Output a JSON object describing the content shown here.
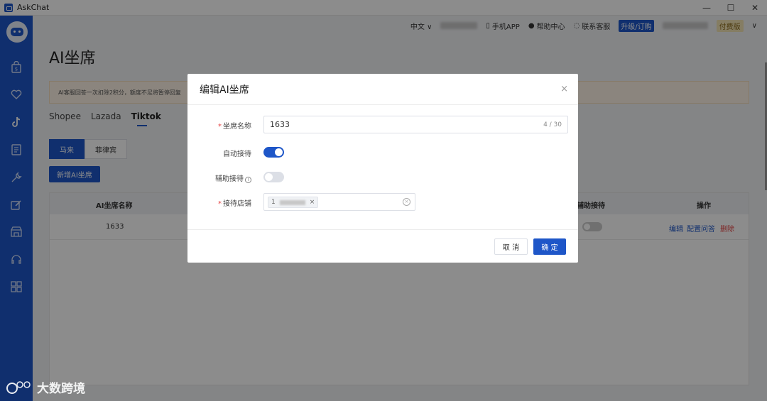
{
  "window": {
    "title": "AskChat",
    "minimize": "—",
    "maximize": "☐",
    "close": "✕"
  },
  "topbar": {
    "language": "中文 ∨",
    "mobile_app": "手机APP",
    "help_center": "帮助中心",
    "customer_service": "联系客服",
    "upgrade": "升级/订购",
    "plan": "付费版",
    "dropdown": "∨"
  },
  "page": {
    "title": "AI坐席",
    "notice": "AI客服回答一次扣除2积分，额度不足将暂停回复",
    "platform_tabs": [
      "Shopee",
      "Lazada",
      "Tiktok"
    ],
    "active_platform": "Tiktok",
    "country_tabs": [
      "马来",
      "菲律宾"
    ],
    "active_country": "马来",
    "add_button": "新增AI坐席"
  },
  "table": {
    "headers": {
      "name": "AI坐席名称",
      "assist": "辅助接待",
      "ops": "操作"
    },
    "rows": [
      {
        "name": "1633",
        "assist_on": false,
        "edit": "编辑",
        "config": "配置问答",
        "delete": "删除"
      }
    ]
  },
  "modal": {
    "title": "编辑AI坐席",
    "close": "×",
    "fields": {
      "name_label": "坐席名称",
      "name_value": "1633",
      "name_counter": "4 / 30",
      "auto_label": "自动接待",
      "auto_on": true,
      "assist_label": "辅助接待",
      "assist_on": false,
      "info_icon": "i",
      "shop_label": "接待店铺",
      "shop_tag_prefix": "1",
      "tag_close": "×",
      "clear": "×"
    },
    "cancel": "取 消",
    "confirm": "确 定"
  },
  "watermark": {
    "text": "大数跨境"
  },
  "colors": {
    "primary": "#1e56c8",
    "danger": "#e64545",
    "notice_bg": "#fdf3e6"
  }
}
